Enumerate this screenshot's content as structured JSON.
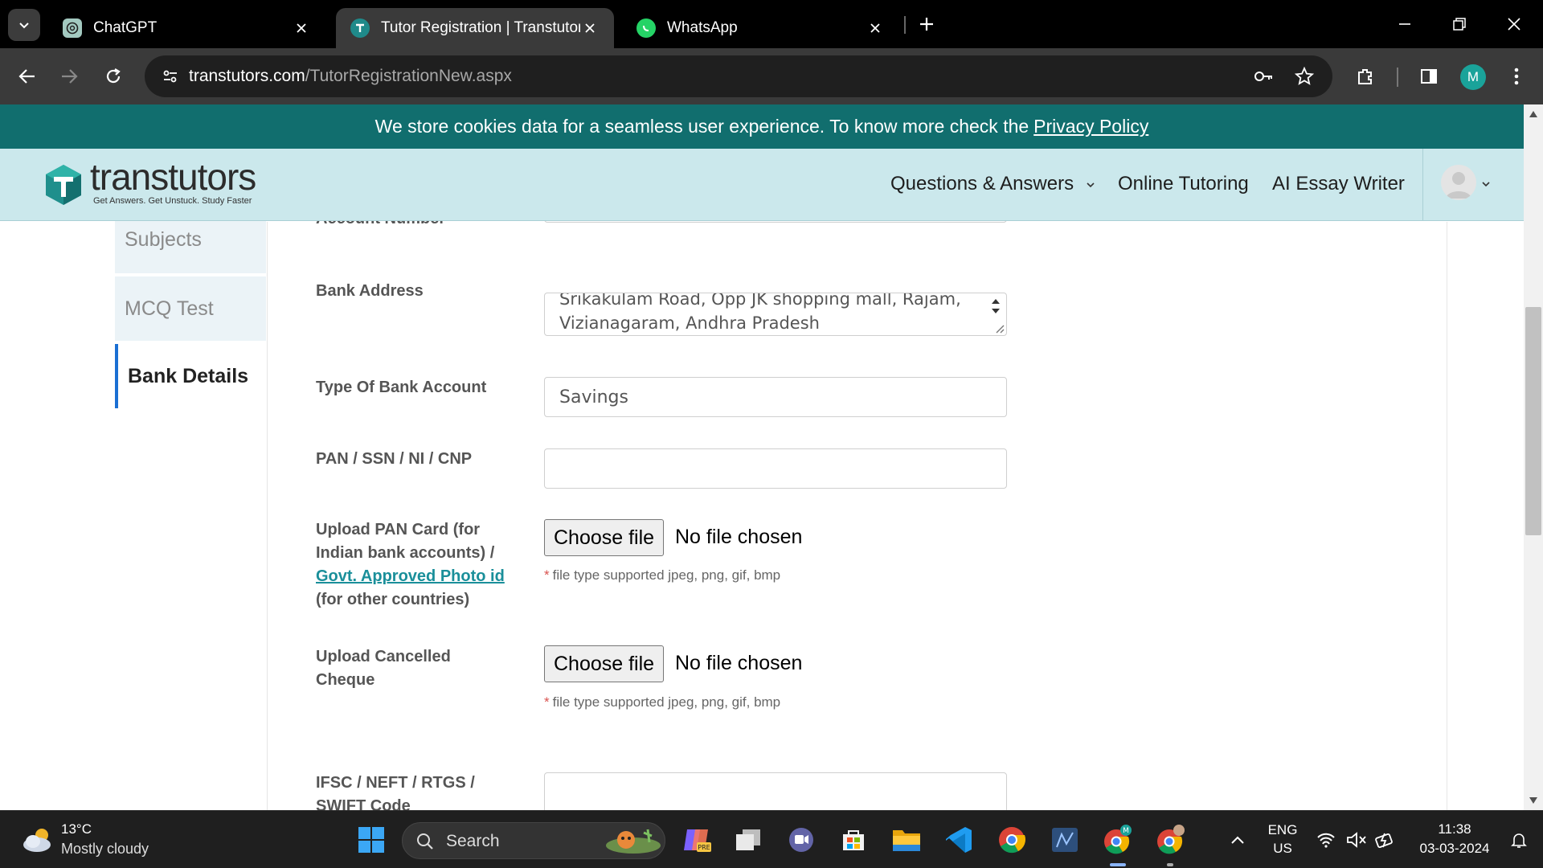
{
  "browser": {
    "tabs": [
      {
        "title": "ChatGPT",
        "active": false,
        "icon": "chatgpt-icon"
      },
      {
        "title": "Tutor Registration | Transtutors",
        "active": true,
        "icon": "transtutors-icon"
      },
      {
        "title": "WhatsApp",
        "active": false,
        "icon": "whatsapp-icon"
      }
    ],
    "url_domain": "transtutors.com",
    "url_path": "/TutorRegistrationNew.aspx",
    "profile_initial": "M"
  },
  "cookie_bar": {
    "text": "We store cookies data for a seamless user experience. To know more check the",
    "link": "Privacy Policy"
  },
  "site": {
    "logo_word": "transtutors",
    "logo_tagline": "Get Answers. Get Unstuck. Study Faster",
    "nav": [
      "Questions & Answers",
      "Online Tutoring",
      "AI Essay Writer"
    ]
  },
  "sidebar": {
    "items": [
      {
        "label": "Subjects",
        "active": false
      },
      {
        "label": "MCQ Test",
        "active": false
      },
      {
        "label": "Bank Details",
        "active": true
      }
    ]
  },
  "form": {
    "account_number_label": "Account Number",
    "account_number_value": "",
    "bank_address_label": "Bank Address",
    "bank_address_value": "Srikakulam Road, Opp JK shopping mall, Rajam, Vizianagaram, Andhra Pradesh",
    "account_type_label": "Type Of Bank Account",
    "account_type_value": "Savings",
    "pan_label": "PAN / SSN / NI / CNP",
    "pan_value": "",
    "upload_pan_label_1": "Upload PAN Card (for Indian bank accounts) /",
    "upload_pan_link": "Govt. Approved Photo id",
    "upload_pan_label_2": "(for other countries)",
    "upload_cheque_label": "Upload Cancelled Cheque",
    "choose_file": "Choose file",
    "no_file": "No file chosen",
    "file_hint_star": "*",
    "file_hint": "file type supported jpeg, png, gif, bmp",
    "ifsc_label": "IFSC / NEFT / RTGS / SWIFT Code"
  },
  "taskbar": {
    "temperature": "13°C",
    "weather": "Mostly cloudy",
    "search_label": "Search",
    "language": "ENG",
    "region": "US",
    "time": "11:38",
    "date": "03-03-2024"
  },
  "colors": {
    "cookie_bar": "#116e6e",
    "header": "#cbe8ec",
    "link": "#1a8f9a",
    "active_tab_border": "#1a6fd3"
  }
}
